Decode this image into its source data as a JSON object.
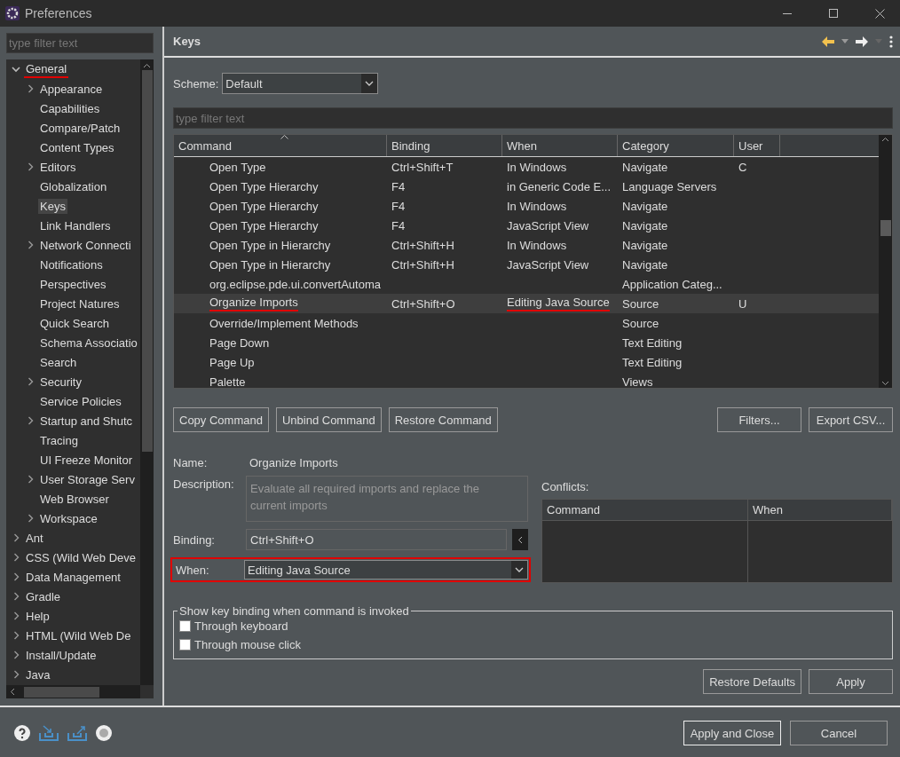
{
  "window": {
    "title": "Preferences"
  },
  "sidebar": {
    "filter": {
      "placeholder": "type filter text"
    },
    "tree": [
      {
        "label": "General",
        "expanded": true,
        "selected": false,
        "underlined": true,
        "children": [
          {
            "label": "Appearance",
            "expanded": false,
            "selected": false
          },
          {
            "label": "Capabilities",
            "selected": false
          },
          {
            "label": "Compare/Patch",
            "selected": false
          },
          {
            "label": "Content Types",
            "selected": false
          },
          {
            "label": "Editors",
            "expanded": false,
            "selected": false
          },
          {
            "label": "Globalization",
            "selected": false
          },
          {
            "label": "Keys",
            "selected": true
          },
          {
            "label": "Link Handlers",
            "selected": false
          },
          {
            "label": "Network Connecti",
            "expanded": false,
            "selected": false
          },
          {
            "label": "Notifications",
            "selected": false
          },
          {
            "label": "Perspectives",
            "selected": false
          },
          {
            "label": "Project Natures",
            "selected": false
          },
          {
            "label": "Quick Search",
            "selected": false
          },
          {
            "label": "Schema Associatio",
            "selected": false
          },
          {
            "label": "Search",
            "selected": false
          },
          {
            "label": "Security",
            "expanded": false,
            "selected": false
          },
          {
            "label": "Service Policies",
            "selected": false
          },
          {
            "label": "Startup and Shutc",
            "expanded": false,
            "selected": false
          },
          {
            "label": "Tracing",
            "selected": false
          },
          {
            "label": "UI Freeze Monitor",
            "selected": false
          },
          {
            "label": "User Storage Serv",
            "expanded": false,
            "selected": false
          },
          {
            "label": "Web Browser",
            "selected": false
          },
          {
            "label": "Workspace",
            "expanded": false,
            "selected": false
          }
        ]
      },
      {
        "label": "Ant",
        "expanded": false,
        "selected": false
      },
      {
        "label": "CSS (Wild Web Deve",
        "expanded": false,
        "selected": false
      },
      {
        "label": "Data Management",
        "expanded": false,
        "selected": false
      },
      {
        "label": "Gradle",
        "expanded": false,
        "selected": false
      },
      {
        "label": "Help",
        "expanded": false,
        "selected": false
      },
      {
        "label": "HTML (Wild Web De",
        "expanded": false,
        "selected": false
      },
      {
        "label": "Install/Update",
        "expanded": false,
        "selected": false
      },
      {
        "label": "Java",
        "expanded": false,
        "selected": false
      }
    ]
  },
  "page": {
    "title": "Keys",
    "scheme": {
      "label": "Scheme:",
      "value": "Default"
    },
    "filter": {
      "placeholder": "type filter text"
    },
    "table": {
      "columns": [
        {
          "label": "Command",
          "sorted": true
        },
        {
          "label": "Binding",
          "sorted": false
        },
        {
          "label": "When",
          "sorted": false
        },
        {
          "label": "Category",
          "sorted": false
        },
        {
          "label": "User",
          "sorted": false
        }
      ],
      "rows": [
        {
          "cells": [
            "Open Type",
            "Ctrl+Shift+T",
            "In Windows",
            "Navigate",
            "C"
          ],
          "selected": false,
          "command_underlined": false,
          "when_underlined": false
        },
        {
          "cells": [
            "Open Type Hierarchy",
            "F4",
            "in Generic Code E...",
            "Language Servers",
            ""
          ],
          "selected": false,
          "command_underlined": false,
          "when_underlined": false
        },
        {
          "cells": [
            "Open Type Hierarchy",
            "F4",
            "In Windows",
            "Navigate",
            ""
          ],
          "selected": false,
          "command_underlined": false,
          "when_underlined": false
        },
        {
          "cells": [
            "Open Type Hierarchy",
            "F4",
            "JavaScript View",
            "Navigate",
            ""
          ],
          "selected": false,
          "command_underlined": false,
          "when_underlined": false
        },
        {
          "cells": [
            "Open Type in Hierarchy",
            "Ctrl+Shift+H",
            "In Windows",
            "Navigate",
            ""
          ],
          "selected": false,
          "command_underlined": false,
          "when_underlined": false
        },
        {
          "cells": [
            "Open Type in Hierarchy",
            "Ctrl+Shift+H",
            "JavaScript View",
            "Navigate",
            ""
          ],
          "selected": false,
          "command_underlined": false,
          "when_underlined": false
        },
        {
          "cells": [
            "org.eclipse.pde.ui.convertAutoma",
            "",
            "",
            "Application Categ...",
            ""
          ],
          "selected": false,
          "command_underlined": false
        },
        {
          "cells": [
            "Organize Imports",
            "Ctrl+Shift+O",
            "Editing Java Source",
            "Source",
            "U"
          ],
          "selected": true,
          "command_underlined": true,
          "when_underlined": true
        },
        {
          "cells": [
            "Override/Implement Methods",
            "",
            "",
            "Source",
            ""
          ],
          "selected": false,
          "command_underlined": false
        },
        {
          "cells": [
            "Page Down",
            "",
            "",
            "Text Editing",
            ""
          ],
          "selected": false,
          "command_underlined": false
        },
        {
          "cells": [
            "Page Up",
            "",
            "",
            "Text Editing",
            ""
          ],
          "selected": false,
          "command_underlined": false
        },
        {
          "cells": [
            "Palette",
            "",
            "",
            "Views",
            ""
          ],
          "selected": false,
          "command_underlined": false
        }
      ]
    },
    "table_buttons": [
      "Copy Command",
      "Unbind Command",
      "Restore Command"
    ],
    "table_buttons_right": [
      "Filters...",
      "Export CSV..."
    ],
    "details": {
      "name": {
        "label": "Name:",
        "value": "Organize Imports"
      },
      "description": {
        "label": "Description:",
        "value": "Evaluate all required imports and replace the current imports"
      },
      "binding": {
        "label": "Binding:",
        "value": "Ctrl+Shift+O"
      },
      "when": {
        "label": "When:",
        "value": "Editing Java Source",
        "outlined": true
      }
    },
    "conflicts": {
      "label": "Conflicts:",
      "columns": [
        "Command",
        "When"
      ]
    },
    "show_binding": {
      "title": "Show key binding when command is invoked",
      "options": [
        {
          "label": "Through keyboard",
          "checked": false
        },
        {
          "label": "Through mouse click",
          "checked": false
        }
      ]
    },
    "page_buttons": [
      "Restore Defaults",
      "Apply"
    ]
  },
  "footer": {
    "buttons": [
      {
        "label": "Apply and Close",
        "default": true
      },
      {
        "label": "Cancel",
        "default": false
      }
    ]
  }
}
